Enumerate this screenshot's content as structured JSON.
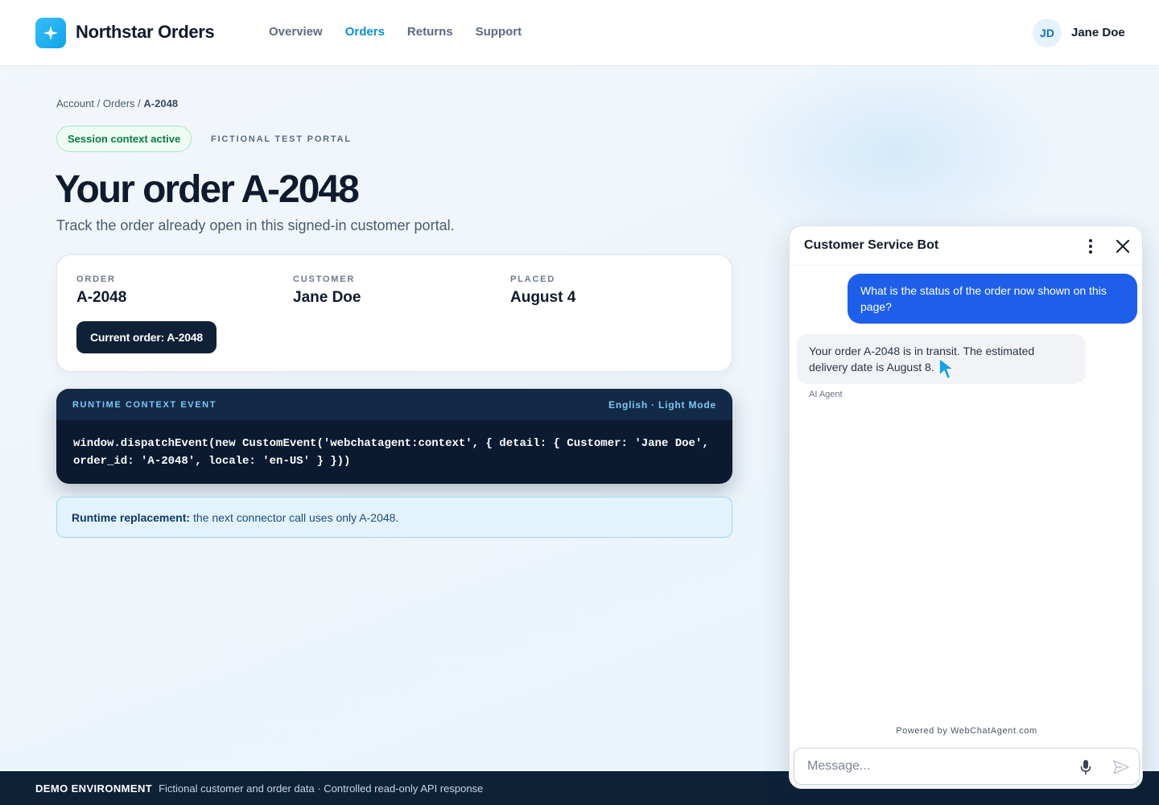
{
  "header": {
    "brand": "Northstar Orders",
    "logo_icon": "sparkle-icon",
    "nav": [
      {
        "label": "Overview",
        "active": false
      },
      {
        "label": "Orders",
        "active": true
      },
      {
        "label": "Returns",
        "active": false
      },
      {
        "label": "Support",
        "active": false
      }
    ],
    "user": {
      "initials": "JD",
      "name": "Jane Doe"
    }
  },
  "breadcrumb": {
    "account": "Account",
    "sep1": " / ",
    "orders": "Orders",
    "sep2": " / ",
    "current": "A-2048"
  },
  "status_pill": "Session context active",
  "portal_tag": "FICTIONAL TEST PORTAL",
  "page": {
    "title": "Your order A-2048",
    "subtitle": "Track the order already open in this signed-in customer portal."
  },
  "order_card": {
    "fields": [
      {
        "label": "ORDER",
        "value": "A-2048"
      },
      {
        "label": "CUSTOMER",
        "value": "Jane Doe"
      },
      {
        "label": "PLACED",
        "value": "August 4"
      }
    ],
    "current_button": "Current order: A-2048"
  },
  "runtime_event": {
    "heading": "RUNTIME CONTEXT EVENT",
    "meta": "English · Light Mode",
    "code": "window.dispatchEvent(new CustomEvent('webchatagent:context', { detail: { Customer: 'Jane Doe', order_id: 'A-2048', locale: 'en-US' } }))"
  },
  "note": {
    "bold": "Runtime replacement:",
    "text": "the next connector call uses only A-2048."
  },
  "footer": {
    "label": "DEMO ENVIRONMENT",
    "text": "Fictional customer and order data · Controlled read-only API response"
  },
  "chat": {
    "title": "Customer Service Bot",
    "menu_icon": "more-vertical-icon",
    "close_icon": "close-icon",
    "messages": [
      {
        "role": "user",
        "text": "What is the status of the order now shown on this page?"
      },
      {
        "role": "bot",
        "text": "Your order A-2048 is in transit. The estimated delivery date is August 8.",
        "sender": "AI Agent"
      }
    ],
    "powered_by": "Powered by WebChatAgent.com",
    "input_placeholder": "Message...",
    "mic_icon": "microphone-icon",
    "send_icon": "send-icon"
  },
  "colors": {
    "accent": "#0b8fd6",
    "user_bubble": "#1d5fe8",
    "dark_navy": "#0e2137",
    "success_green": "#0b7a43"
  }
}
